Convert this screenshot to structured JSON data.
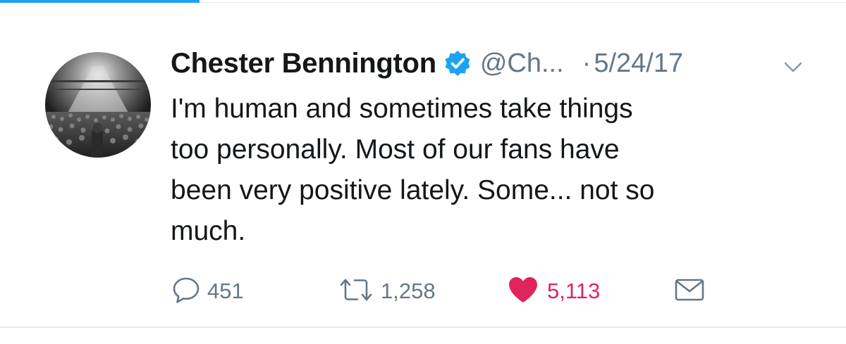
{
  "tweet": {
    "display_name": "Chester Bennington",
    "verified": true,
    "handle": "@Ch...",
    "separator": "·",
    "timestamp": "5/24/17",
    "text": "I'm human and sometimes take things\ntoo personally. Most of our fans have\nbeen very positive lately. Some... not so\nmuch.",
    "avatar_icon": "concert-crowd-avatar",
    "actions": {
      "reply": {
        "icon": "reply-icon",
        "count": "451"
      },
      "retweet": {
        "icon": "retweet-icon",
        "count": "1,258"
      },
      "like": {
        "icon": "heart-icon",
        "count": "5,113",
        "liked": true
      },
      "dm": {
        "icon": "envelope-icon"
      }
    }
  },
  "colors": {
    "accent_blue": "#1da1f2",
    "text_primary": "#14171a",
    "text_secondary": "#657786",
    "like_red": "#e0245e",
    "divider": "#e6ecf0"
  }
}
